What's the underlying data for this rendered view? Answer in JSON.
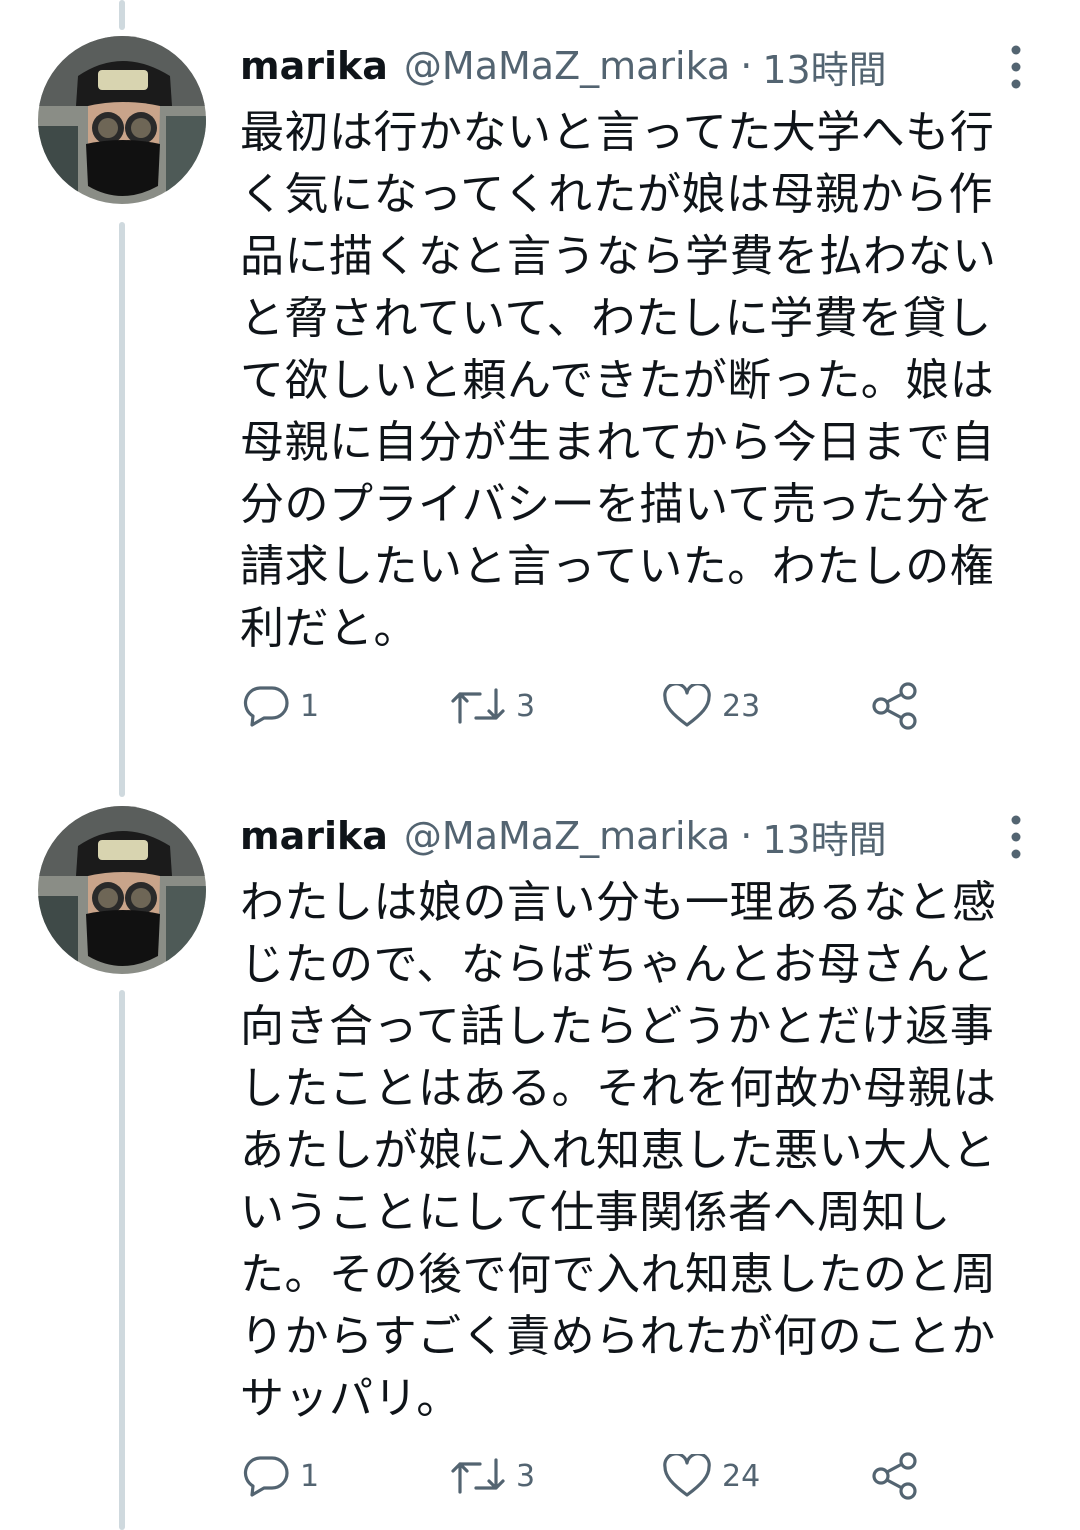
{
  "tweets": [
    {
      "display_name": "marika",
      "handle": "@MaMaZ_marika",
      "separator": "·",
      "time": "13時間",
      "text": "最初は行かないと言ってた大学へも行\nく気になってくれたが娘は母親から作\n品に描くなと言うなら学費を払わない\nと脅されていて、わたしに学費を貸し\nて欲しいと頼んできたが断った。娘は\n母親に自分が生まれてから今日まで自\n分のプライバシーを描いて売った分を\n請求したいと言っていた。わたしの権\n利だと。",
      "reply_count": "1",
      "retweet_count": "3",
      "like_count": "23"
    },
    {
      "display_name": "marika",
      "handle": "@MaMaZ_marika",
      "separator": "·",
      "time": "13時間",
      "text": "わたしは娘の言い分も一理あるなと感\nじたので、ならばちゃんとお母さんと\n向き合って話したらどうかとだけ返事\nしたことはある。それを何故か母親は\nあたしが娘に入れ知恵した悪い大人と\nいうことにして仕事関係者へ周知し\nた。その後で何で入れ知恵したのと周\nりからすごく責められたが何のことか\nサッパリ。",
      "reply_count": "1",
      "retweet_count": "3",
      "like_count": "24"
    }
  ],
  "colors": {
    "text": "#0f1419",
    "secondary": "#536471",
    "thread_line": "#cfd9de"
  },
  "icons": {
    "reply": "reply-icon",
    "retweet": "retweet-icon",
    "like": "like-icon",
    "share": "share-icon",
    "more": "more-options-icon"
  }
}
